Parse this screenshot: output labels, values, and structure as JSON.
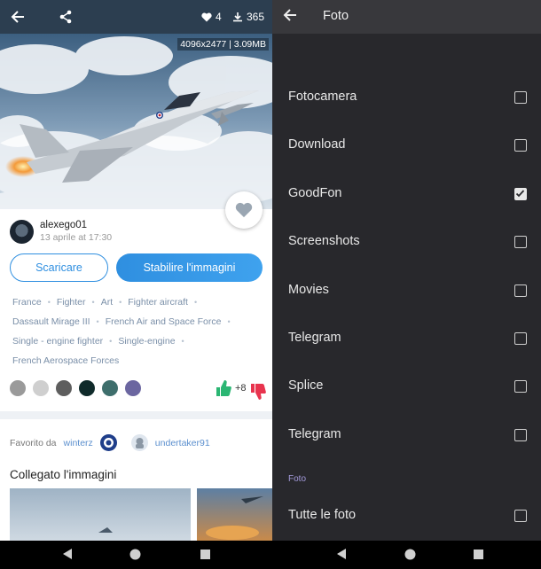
{
  "left": {
    "stats": {
      "likes": "4",
      "downloads": "365"
    },
    "image_info": "4096x2477 | 3.09MB",
    "author": {
      "name": "alexego01",
      "date": "13 aprile at 17:30"
    },
    "buttons": {
      "download": "Scaricare",
      "set": "Stabilire l'immagini"
    },
    "tags": [
      "France",
      "Fighter",
      "Art",
      "Fighter aircraft",
      "Dassault Mirage III",
      "French Air and Space Force",
      "Single - engine fighter",
      "Single-engine",
      "French Aerospace Forces"
    ],
    "swatches": [
      "#9a9a9a",
      "#cfcfcf",
      "#5e5e5e",
      "#0f2a2a",
      "#3e6e6c",
      "#6b66a0"
    ],
    "rating": "+8",
    "favorited": {
      "label": "Favorito da",
      "users": [
        "winterz",
        "undertaker91"
      ]
    },
    "related_title": "Collegato l'immagini"
  },
  "right": {
    "title": "Foto",
    "albums": [
      {
        "label": "Fotocamera",
        "checked": false
      },
      {
        "label": "Download",
        "checked": false
      },
      {
        "label": "GoodFon",
        "checked": true
      },
      {
        "label": "Screenshots",
        "checked": false
      },
      {
        "label": "Movies",
        "checked": false
      },
      {
        "label": "Telegram",
        "checked": false
      },
      {
        "label": "Splice",
        "checked": false
      },
      {
        "label": "Telegram",
        "checked": false
      }
    ],
    "section": "Foto",
    "all_photos": {
      "label": "Tutte le foto",
      "checked": false
    }
  },
  "colors": {
    "accent": "#2f8fe0",
    "topbar_left": "#2c3e50",
    "dark_bg": "#28282c",
    "like_green": "#2bb673",
    "dislike_red": "#e8344e"
  },
  "icons": [
    "back-arrow-icon",
    "share-icon",
    "heart-icon",
    "download-icon",
    "thumbs-up-icon",
    "thumbs-down-icon",
    "checkbox-icon"
  ]
}
